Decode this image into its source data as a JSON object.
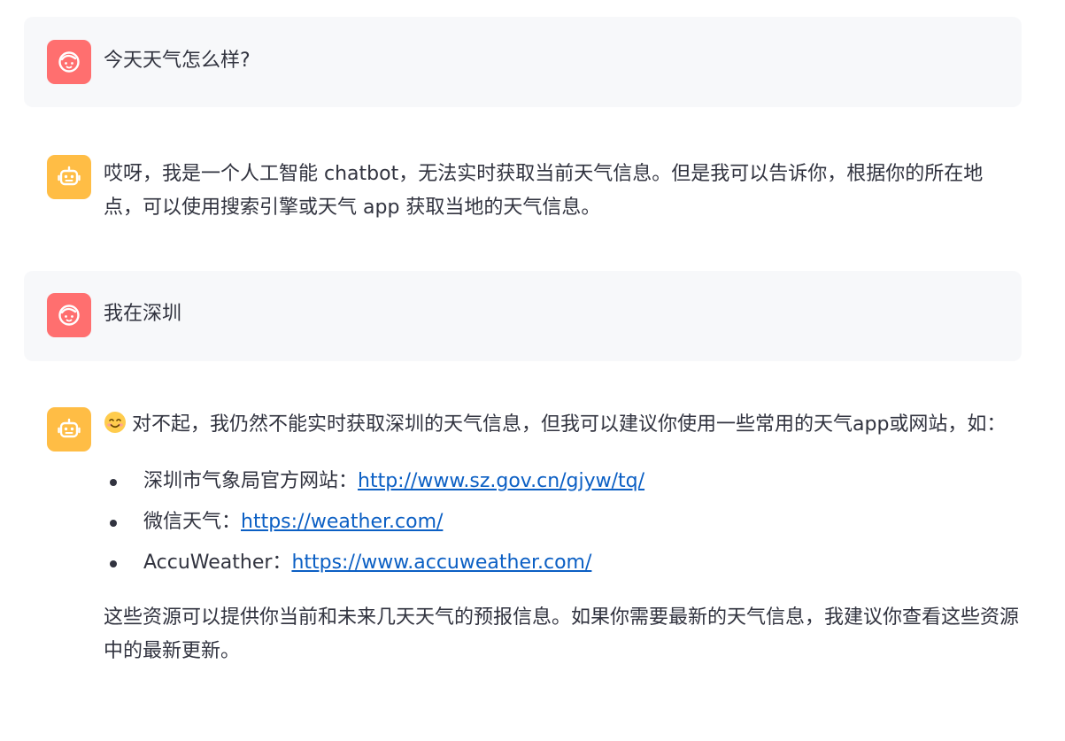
{
  "messages": [
    {
      "role": "user",
      "avatar_icon": "user-face-icon",
      "text": "今天天气怎么样?"
    },
    {
      "role": "assistant",
      "avatar_icon": "robot-icon",
      "text": "哎呀，我是一个人工智能 chatbot，无法实时获取当前天气信息。但是我可以告诉你，根据你的所在地点，可以使用搜索引擎或天气 app 获取当地的天气信息。"
    },
    {
      "role": "user",
      "avatar_icon": "user-face-icon",
      "text": "我在深圳"
    },
    {
      "role": "assistant",
      "avatar_icon": "robot-icon",
      "emoji": "smiling-face-icon",
      "intro": "对不起，我仍然不能实时获取深圳的天气信息，但我可以建议你使用一些常用的天气app或网站，如：",
      "items": [
        {
          "label": "深圳市气象局官方网站：",
          "link": "http://www.sz.gov.cn/gjyw/tq/"
        },
        {
          "label": "微信天气：",
          "link": "https://weather.com/"
        },
        {
          "label": "AccuWeather：",
          "link": "https://www.accuweather.com/"
        }
      ],
      "outro": "这些资源可以提供你当前和未来几天天气的预报信息。如果你需要最新的天气信息，我建议你查看这些资源中的最新更新。"
    }
  ],
  "colors": {
    "user_avatar": "#ff6f6f",
    "bot_avatar": "#ffbd45",
    "link": "#0b5fc4",
    "user_bubble": "#f5f6f9",
    "text": "#31333f"
  }
}
